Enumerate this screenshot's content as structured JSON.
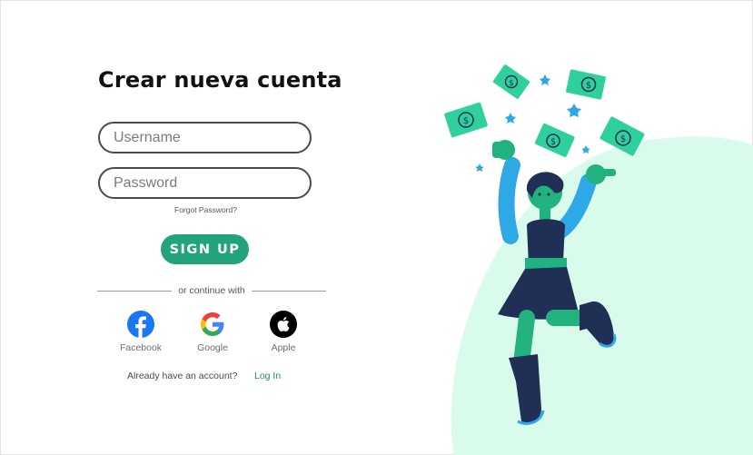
{
  "form": {
    "title": "Crear nueva cuenta",
    "username_placeholder": "Username",
    "password_placeholder": "Password",
    "forgot_password": "Forgot Password?",
    "signup_label": "SIGN UP",
    "divider_text": "or continue with"
  },
  "social": [
    {
      "label": "Facebook",
      "icon": "facebook-icon"
    },
    {
      "label": "Google",
      "icon": "google-icon"
    },
    {
      "label": "Apple",
      "icon": "apple-icon"
    }
  ],
  "footer": {
    "already_text": "Already have an account?",
    "login_label": "Log In"
  },
  "colors": {
    "accent": "#22a37c",
    "link": "#1f8f6b",
    "illustration_bg": "#d9fbec",
    "money": "#2fd09b",
    "navy": "#1f2f55",
    "sky": "#2fa8e6"
  }
}
